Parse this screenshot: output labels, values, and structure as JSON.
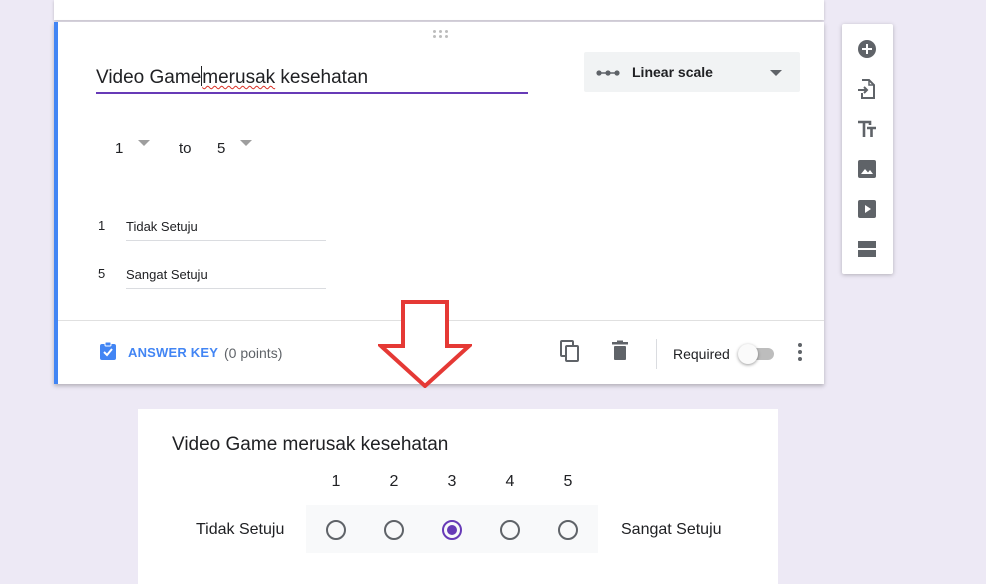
{
  "question": {
    "title_before_caret": "Video Game",
    "title_spell_word": "merusak",
    "title_after": " kesehatan",
    "type_label": "Linear scale",
    "type_icon": "linear-scale-icon",
    "range": {
      "from": "1",
      "to_label": "to",
      "to": "5"
    },
    "labels": [
      {
        "value": "1",
        "text": "Tidak Setuju"
      },
      {
        "value": "5",
        "text": "Sangat Setuju"
      }
    ]
  },
  "footer": {
    "answer_key_label": "ANSWER KEY",
    "points": "(0 points)",
    "required_label": "Required",
    "required_on": false
  },
  "toolbar": {
    "items": [
      "add-question-icon",
      "import-questions-icon",
      "add-title-icon",
      "add-image-icon",
      "add-video-icon",
      "add-section-icon"
    ]
  },
  "preview": {
    "title": "Video Game merusak kesehatan",
    "scale": [
      "1",
      "2",
      "3",
      "4",
      "5"
    ],
    "selected": "3",
    "left_label": "Tidak Setuju",
    "right_label": "Sangat Setuju"
  },
  "colors": {
    "accent_purple": "#673ab7",
    "accent_blue": "#4285f4",
    "arrow_red": "#e53935",
    "background": "#ede9f5"
  }
}
